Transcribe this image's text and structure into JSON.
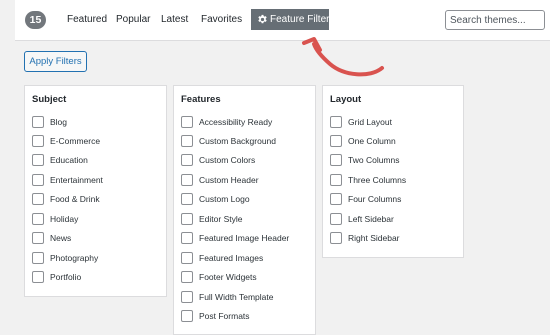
{
  "theme_count": "15",
  "tabs": [
    {
      "label": "Featured"
    },
    {
      "label": "Popular"
    },
    {
      "label": "Latest"
    },
    {
      "label": "Favorites"
    }
  ],
  "feature_filter_label": "Feature Filter",
  "search": {
    "placeholder": "Search themes...",
    "value": ""
  },
  "apply_filters_label": "Apply Filters",
  "columns": [
    {
      "heading": "Subject",
      "options": [
        "Blog",
        "E-Commerce",
        "Education",
        "Entertainment",
        "Food & Drink",
        "Holiday",
        "News",
        "Photography",
        "Portfolio"
      ]
    },
    {
      "heading": "Features",
      "options": [
        "Accessibility Ready",
        "Custom Background",
        "Custom Colors",
        "Custom Header",
        "Custom Logo",
        "Editor Style",
        "Featured Image Header",
        "Featured Images",
        "Footer Widgets",
        "Full Width Template",
        "Post Formats"
      ]
    },
    {
      "heading": "Layout",
      "options": [
        "Grid Layout",
        "One Column",
        "Two Columns",
        "Three Columns",
        "Four Columns",
        "Left Sidebar",
        "Right Sidebar"
      ]
    }
  ],
  "colors": {
    "annotation_arrow": "#d9534f",
    "active_button": "#666e75",
    "link_blue": "#2271b1"
  }
}
